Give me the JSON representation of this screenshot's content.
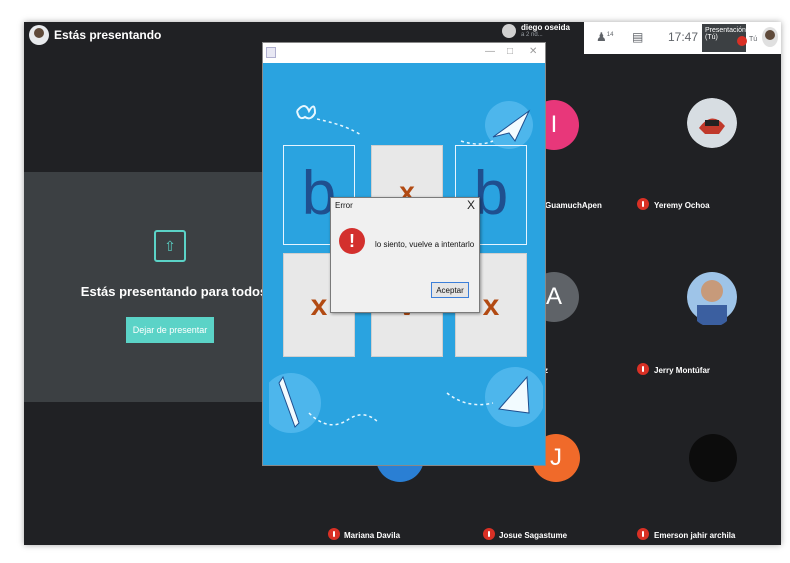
{
  "meeting": {
    "presenting_title": "Estás presentando",
    "present_message": "Estás presentando para todos",
    "stop_button": "Dejar de presentar"
  },
  "topbar": {
    "people_count": "14",
    "clock": "17:47",
    "mini_share_label": "Presentación (Tú)",
    "you_label": "Tú"
  },
  "speaker": {
    "name": "diego oseida",
    "sub": "a 2 nd..."
  },
  "participants": [
    {
      "name": "GuamuchApen",
      "initial": "I",
      "color": "#e8377a"
    },
    {
      "name": "Yeremy Ochoa",
      "initial": "",
      "color": "#d7dde2"
    },
    {
      "name": "",
      "initial": "A",
      "color": "#5f6368"
    },
    {
      "name": "Jerry Montúfar",
      "initial": "",
      "color": "#9ec4e8"
    },
    {
      "name": "Mariana Davila",
      "initial": "M",
      "color": "#2a7fd4"
    },
    {
      "name": "Josue Sagastume",
      "initial": "J",
      "color": "#f06a2a"
    },
    {
      "name": "Emerson jahir archila",
      "initial": "",
      "color": "#0c0c0c"
    }
  ],
  "game": {
    "cards_top": [
      "b",
      "x",
      "b"
    ],
    "cards_bottom": [
      "x",
      "v",
      "x"
    ]
  },
  "dialog": {
    "title": "Error",
    "message": "lo siento, vuelve a intentarlo",
    "ok": "Aceptar",
    "close": "X",
    "icon": "!"
  }
}
